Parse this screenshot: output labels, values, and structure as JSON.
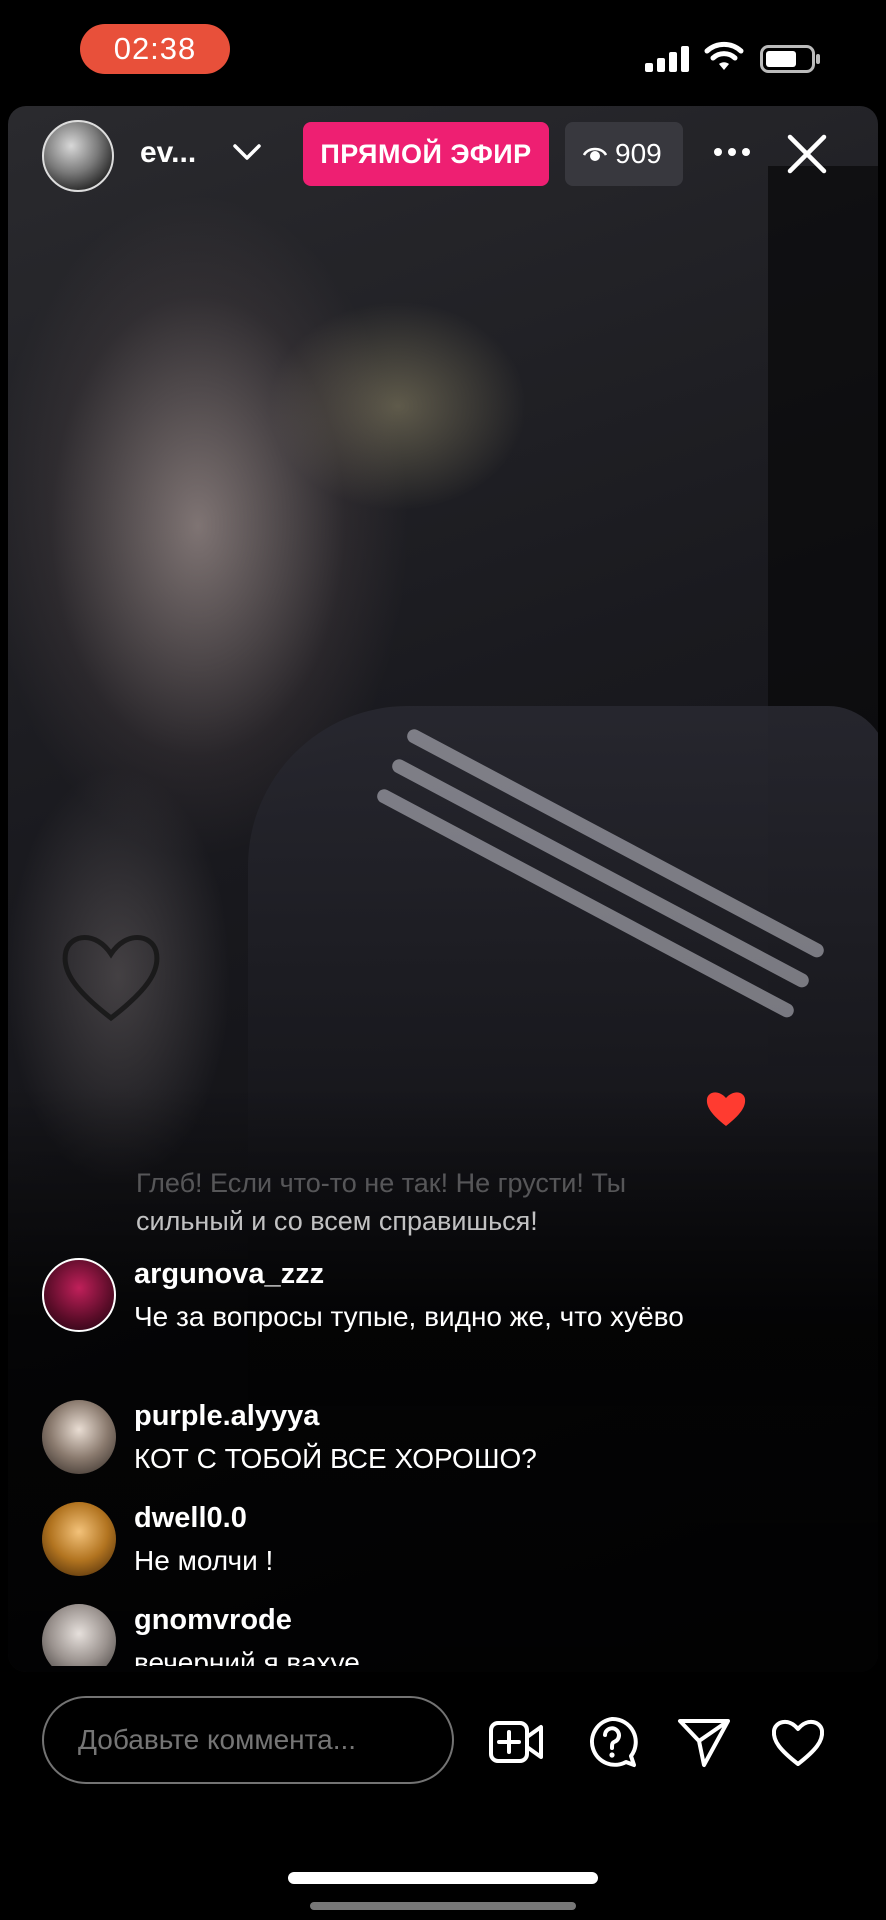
{
  "status_bar": {
    "time": "02:38"
  },
  "header": {
    "host_name": "ev...",
    "live_label": "ПРЯМОЙ ЭФИР",
    "viewer_count": "909"
  },
  "chat": {
    "previous_comment_faded": "Глеб! Если что-то не так! Не грусти! Ты",
    "previous_comment": "сильный и со всем справишься!",
    "comments": [
      {
        "username": "argunova_zzz",
        "text": "Че за вопросы тупые, видно же, что хуёво"
      },
      {
        "username": "purple.alyyya",
        "text": "КОТ С ТОБОЙ ВСЕ ХОРОШО?"
      },
      {
        "username": "dwell0.0",
        "text": "Не молчи !"
      },
      {
        "username": "gnomvrode",
        "text": "вечерний я вахуе"
      }
    ]
  },
  "composer": {
    "placeholder": "Добавьте коммента..."
  },
  "colors": {
    "live_badge": "#ee1f72",
    "time_pill": "#e8503a",
    "heart": "#ff3b30"
  }
}
